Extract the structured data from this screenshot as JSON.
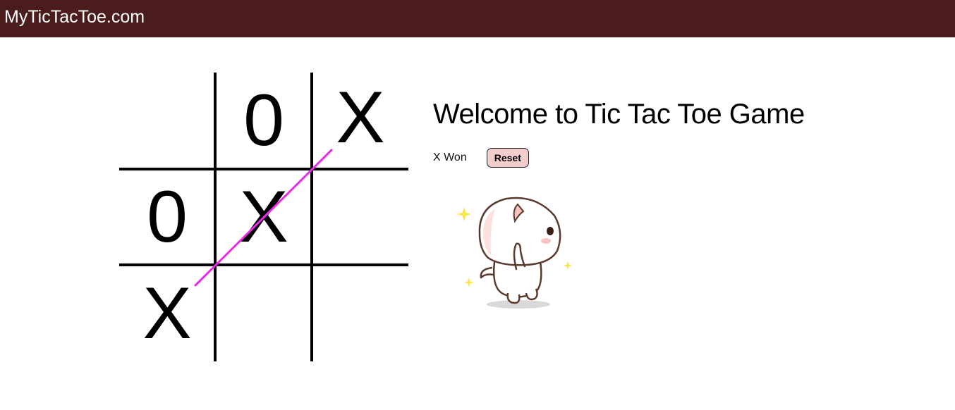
{
  "navbar": {
    "brand": "MyTicTacToe.com",
    "background": "#4a1c1c"
  },
  "game": {
    "title": "Welcome to Tic Tac Toe Game",
    "status": "X Won",
    "reset_label": "Reset",
    "reset_color": "#f3cccc",
    "win_line_color": "#e62ee6",
    "board": [
      [
        "",
        "0",
        "X"
      ],
      [
        "0",
        "X",
        ""
      ],
      [
        "X",
        "",
        ""
      ]
    ],
    "winning_line": "anti-diagonal"
  },
  "sticker": {
    "icon": "dancing-cat-sticker"
  }
}
